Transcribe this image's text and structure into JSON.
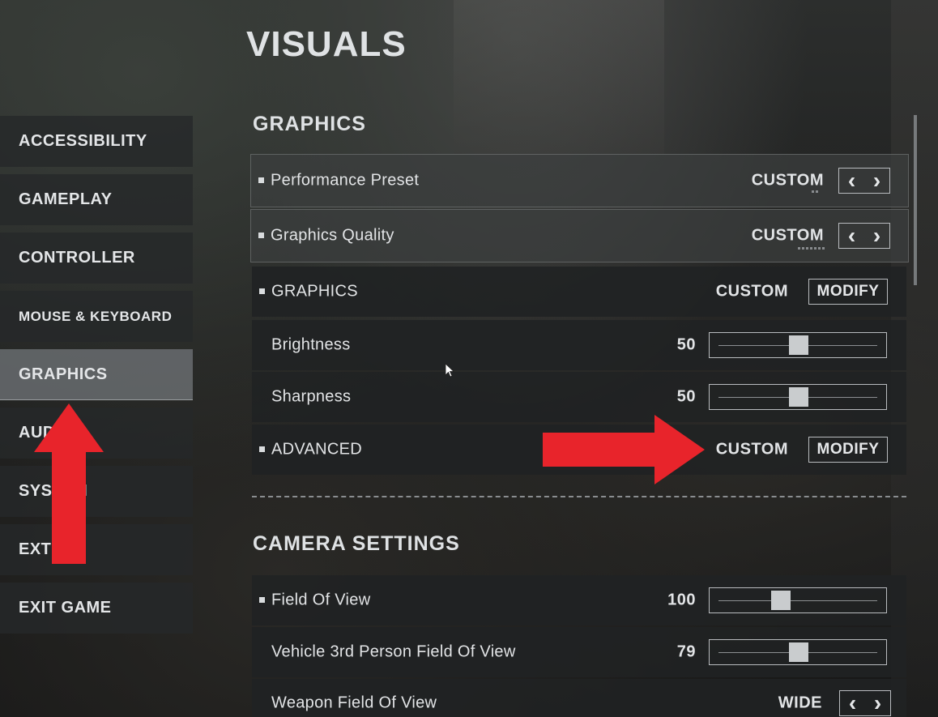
{
  "page": {
    "title": "VISUALS"
  },
  "sidebar": {
    "items": [
      {
        "label": "ACCESSIBILITY"
      },
      {
        "label": "GAMEPLAY"
      },
      {
        "label": "CONTROLLER"
      },
      {
        "label": "MOUSE & KEYBOARD"
      },
      {
        "label": "GRAPHICS",
        "active": true
      },
      {
        "label": "AUDIO"
      },
      {
        "label": "SYSTEM"
      },
      {
        "label": "EXTRAS"
      },
      {
        "label": "EXIT GAME"
      }
    ]
  },
  "graphics": {
    "section_title": "GRAPHICS",
    "performance_preset": {
      "label": "Performance Preset",
      "value": "CUSTOM",
      "prev": "<",
      "next": ">"
    },
    "graphics_quality": {
      "label": "Graphics Quality",
      "value": "CUSTOM",
      "prev": "<",
      "next": ">"
    },
    "graphics": {
      "label": "GRAPHICS",
      "value": "CUSTOM",
      "button": "MODIFY"
    },
    "brightness": {
      "label": "Brightness",
      "value": "50",
      "level": 0.5
    },
    "sharpness": {
      "label": "Sharpness",
      "value": "50",
      "level": 0.5
    },
    "advanced": {
      "label": "ADVANCED",
      "value": "CUSTOM",
      "button": "MODIFY"
    }
  },
  "camera": {
    "section_title": "CAMERA SETTINGS",
    "field_of_view": {
      "label": "Field Of View",
      "value": "100",
      "level": 0.38
    },
    "vehicle_fov": {
      "label": "Vehicle 3rd Person Field Of View",
      "value": "79",
      "level": 0.5
    },
    "weapon_fov": {
      "label": "Weapon Field Of View",
      "value": "WIDE",
      "prev": "<",
      "next": ">"
    }
  },
  "colors": {
    "annotation_arrow": "#e8242b",
    "active_tab": "#696c70",
    "row_bg": "#202224"
  }
}
